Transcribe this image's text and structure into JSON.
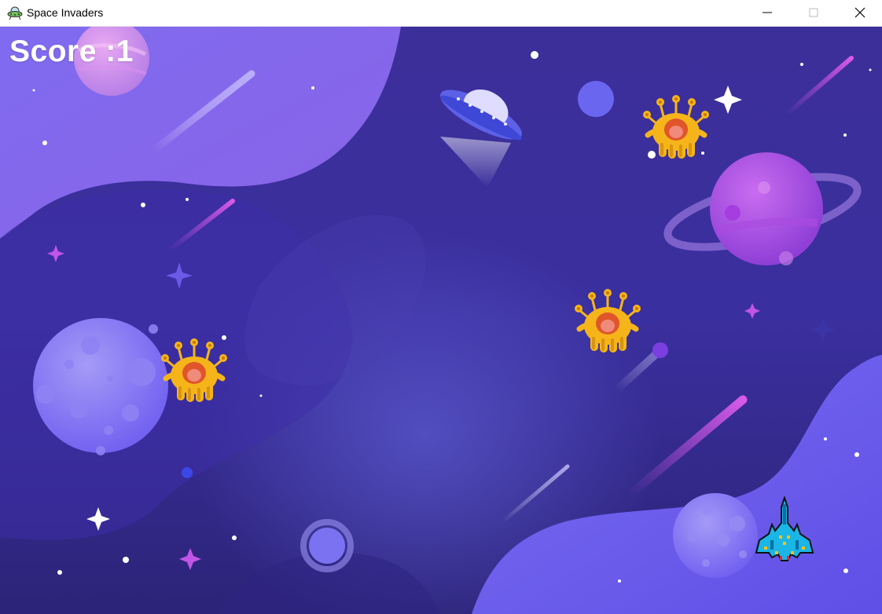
{
  "window": {
    "title": "Space Invaders",
    "app_icon": "ufo-icon",
    "controls": [
      "minimize-icon",
      "maximize-icon",
      "close-icon"
    ]
  },
  "hud": {
    "score_text": "Score :1"
  },
  "colors": {
    "background": "#3a2f9e",
    "alien_body": "#f5b51a",
    "ship": "#19b6e6"
  }
}
